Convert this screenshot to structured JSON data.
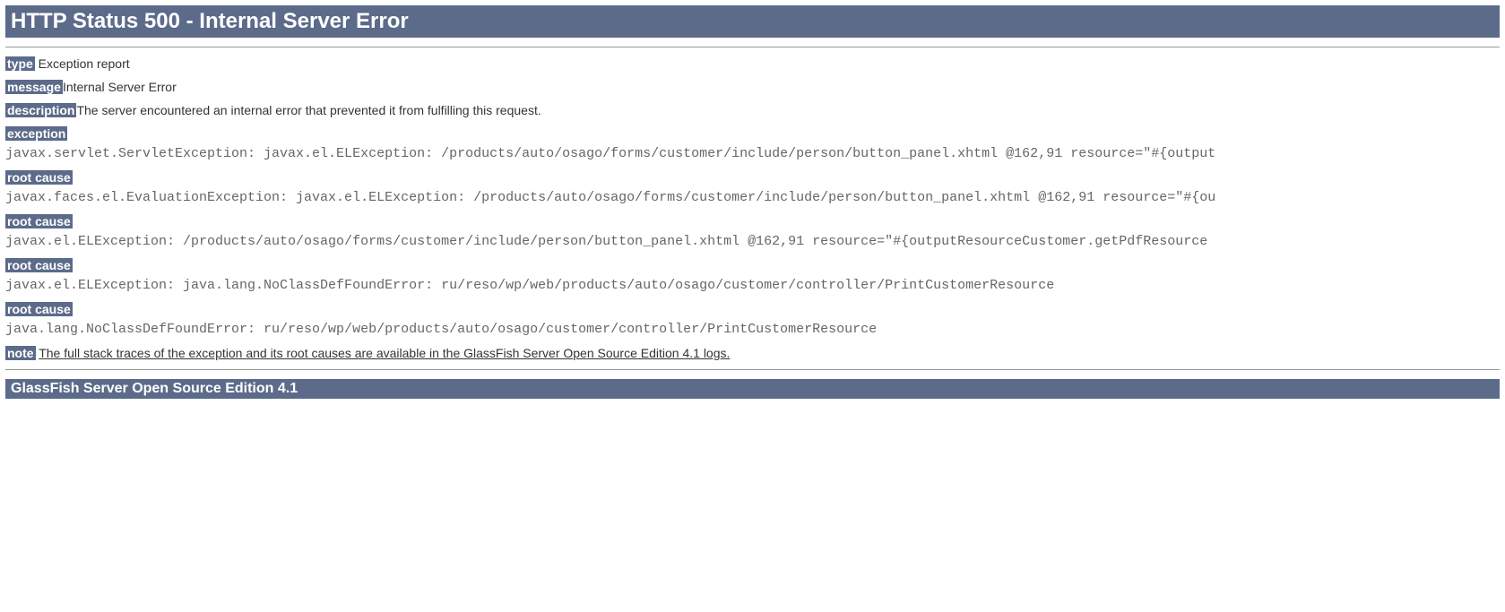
{
  "header": {
    "title": "HTTP Status 500 - Internal Server Error"
  },
  "labels": {
    "type": "type",
    "message": "message",
    "description": "description",
    "exception": "exception",
    "root_cause": "root cause",
    "note": "note"
  },
  "fields": {
    "type_value": " Exception report",
    "message_value": "Internal Server Error",
    "description_value": "The server encountered an internal error that prevented it from fulfilling this request."
  },
  "traces": {
    "exception": "javax.servlet.ServletException: javax.el.ELException: /products/auto/osago/forms/customer/include/person/button_panel.xhtml @162,91 resource=\"#{output",
    "root_cause_1": "javax.faces.el.EvaluationException: javax.el.ELException: /products/auto/osago/forms/customer/include/person/button_panel.xhtml @162,91 resource=\"#{ou",
    "root_cause_2": "javax.el.ELException: /products/auto/osago/forms/customer/include/person/button_panel.xhtml @162,91 resource=\"#{outputResourceCustomer.getPdfResource",
    "root_cause_3": "javax.el.ELException: java.lang.NoClassDefFoundError: ru/reso/wp/web/products/auto/osago/customer/controller/PrintCustomerResource",
    "root_cause_4": "java.lang.NoClassDefFoundError: ru/reso/wp/web/products/auto/osago/customer/controller/PrintCustomerResource"
  },
  "note_text": "The full stack traces of the exception and its root causes are available in the GlassFish Server Open Source Edition 4.1 logs.",
  "footer": {
    "server": "GlassFish Server Open Source Edition 4.1"
  }
}
